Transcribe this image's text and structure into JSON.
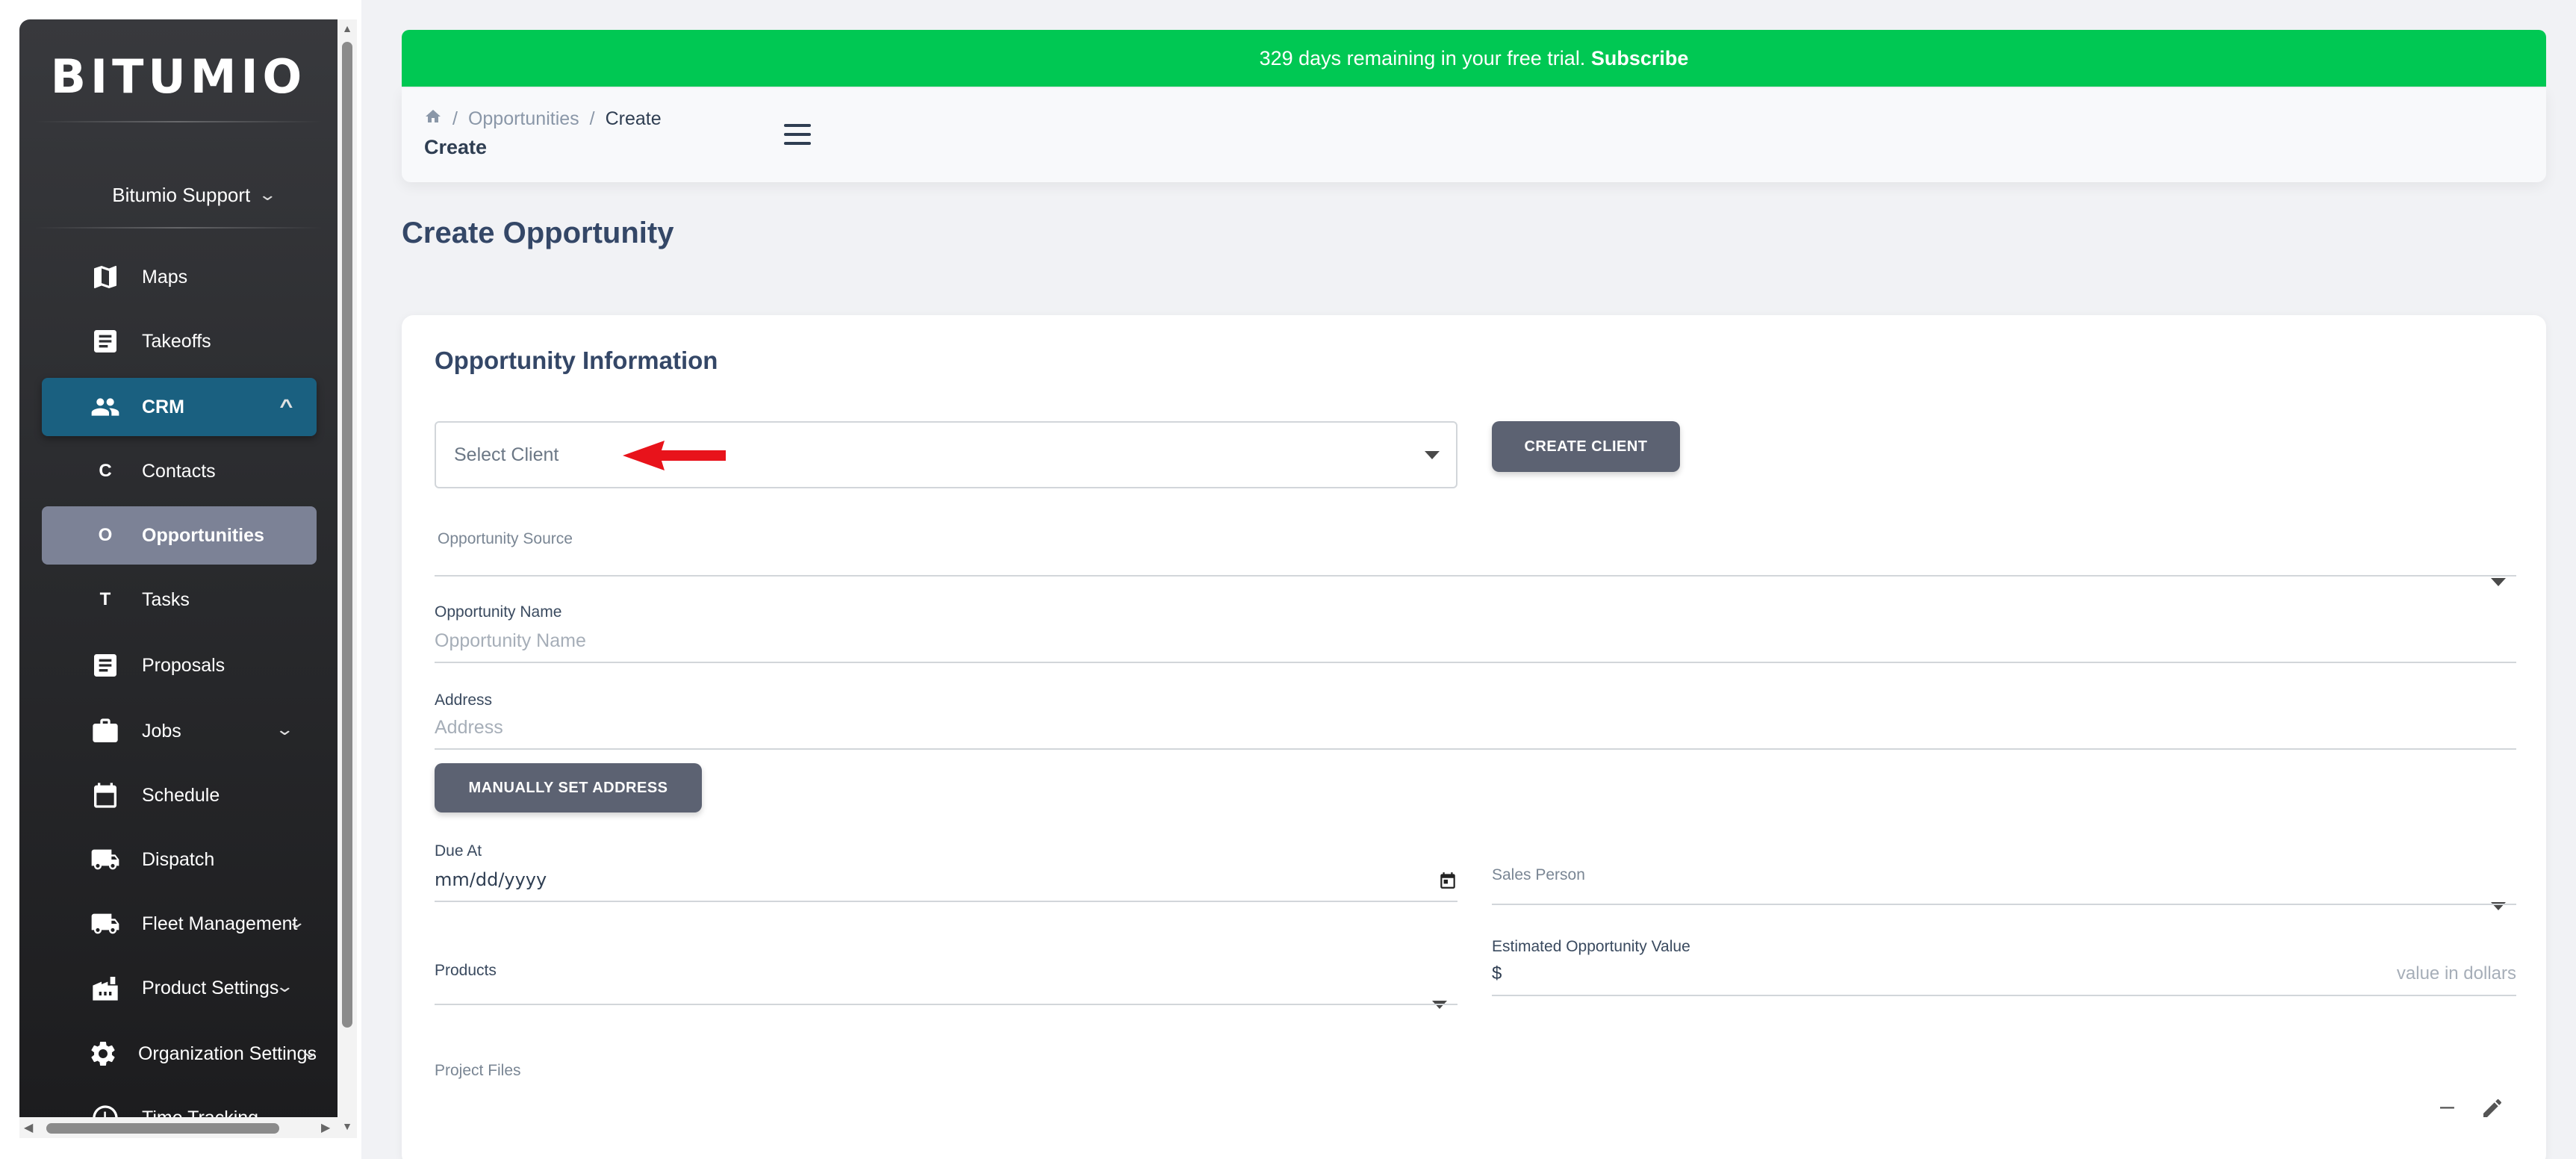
{
  "sidebar": {
    "logo": "BITUMIO",
    "user": "Bitumio Support",
    "items": [
      {
        "label": "Maps",
        "icon": "map-icon"
      },
      {
        "label": "Takeoffs",
        "icon": "document-icon"
      },
      {
        "label": "CRM",
        "icon": "people-icon"
      },
      {
        "label": "Contacts",
        "letter": "C"
      },
      {
        "label": "Opportunities",
        "letter": "O"
      },
      {
        "label": "Tasks",
        "letter": "T"
      },
      {
        "label": "Proposals",
        "icon": "document-icon"
      },
      {
        "label": "Jobs",
        "icon": "briefcase-icon"
      },
      {
        "label": "Schedule",
        "icon": "calendar-icon"
      },
      {
        "label": "Dispatch",
        "icon": "truck-icon"
      },
      {
        "label": "Fleet Management",
        "icon": "truck-icon"
      },
      {
        "label": "Product Settings",
        "icon": "factory-icon"
      },
      {
        "label": "Organization Settings",
        "icon": "gear-icon"
      },
      {
        "label": "Time Tracking",
        "icon": "clock-icon"
      }
    ]
  },
  "banner": {
    "text": "329 days remaining in your free trial.",
    "link": "Subscribe",
    "color": "#00c853"
  },
  "breadcrumb": {
    "items": [
      "Opportunities",
      "Create"
    ],
    "title": "Create"
  },
  "page": {
    "title": "Create Opportunity"
  },
  "form": {
    "section_title": "Opportunity Information",
    "select_client_placeholder": "Select Client",
    "create_client_button": "CREATE CLIENT",
    "opportunity_source_label": "Opportunity Source",
    "opportunity_name_label": "Opportunity Name",
    "opportunity_name_placeholder": "Opportunity Name",
    "address_label": "Address",
    "address_placeholder": "Address",
    "manual_address_button": "MANUALLY SET ADDRESS",
    "due_at_label": "Due At",
    "due_at_value": "mm/dd/yyyy",
    "sales_person_label": "Sales Person",
    "products_label": "Products",
    "estimated_value_label": "Estimated Opportunity Value",
    "currency_symbol": "$",
    "estimated_value_hint": "value in dollars",
    "project_files_label": "Project Files"
  },
  "colors": {
    "crm_active": "#1a6080",
    "opportunities_active": "#7c8296",
    "button_dark": "#5c6272",
    "annotation_arrow": "#e8131b"
  }
}
